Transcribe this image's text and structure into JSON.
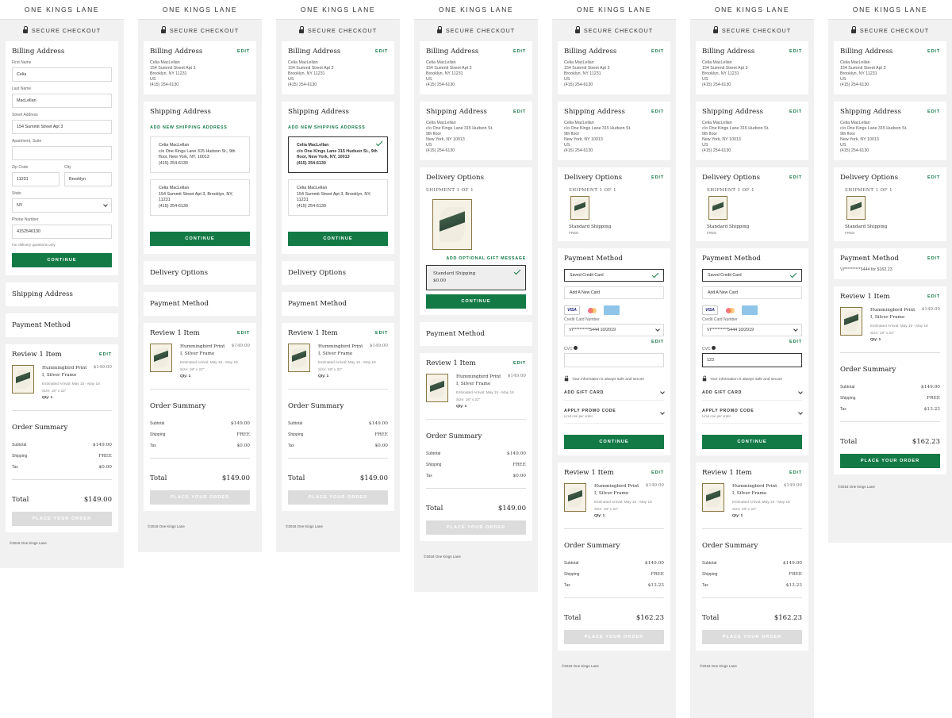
{
  "brand": "ONE KINGS LANE",
  "secure": "SECURE CHECKOUT",
  "footer": "©2018 One Kings Lane",
  "titles": {
    "billing": "Billing Address",
    "shipping": "Shipping Address",
    "delivery": "Delivery Options",
    "payment": "Payment Method",
    "review": "Review 1 Item",
    "summary": "Order Summary"
  },
  "edit": "EDIT",
  "billing_form": {
    "first_name_label": "First Name",
    "first_name": "Celia",
    "last_name_label": "Last Name",
    "last_name": "MacLellan",
    "street_label": "Street Address",
    "street": "154 Summit Street Apt 3",
    "apt_label": "Apartment, Suite",
    "apt": "",
    "zip_label": "Zip Code",
    "zip": "11231",
    "city_label": "City",
    "city": "Brooklyn",
    "state_label": "State",
    "state": "NY",
    "phone_label": "Phone Number",
    "phone": "4152546130",
    "note": "For delivery questions only"
  },
  "billing_addr": [
    "Celia MacLellan",
    "154 Summit Street Apt 3",
    "Brooklyn, NY 11231",
    "US",
    "(415) 254-6130"
  ],
  "shipping_addr": [
    "Celia MacLellan",
    "c/o One Kings Lane 315 Hudson St.",
    "9th floor",
    "New York, NY 10013",
    "US",
    "(415) 254-6130"
  ],
  "add_shipping": "ADD NEW SHIPPING ADDRESS",
  "ship_opts": [
    {
      "lines": [
        "Celia MacLellan",
        "c/o One Kings Lane 315 Hudson St., 9th floor, New York, NY, 10013",
        "(415) 254-6130"
      ]
    },
    {
      "lines": [
        "Celia MacLellan",
        "154 Summit Street Apt 3, Brooklyn, NY, 11231",
        "(415) 254-6130"
      ]
    }
  ],
  "continue": "CONTINUE",
  "place_order": "PLACE YOUR ORDER",
  "shipment": "SHIPMENT 1 OF 1",
  "gift": "ADD OPTIONAL GIFT MESSAGE",
  "std_ship": "Standard Shipping",
  "std_price": "$0.00",
  "free": "FREE",
  "payment": {
    "saved": "Saved Credit Card",
    "add_new": "Add A New Card",
    "cc_label": "Credit Card Number",
    "cc_value": "VI**********5444 10/2019",
    "cvc_label": "CVC",
    "cvc_value": "123",
    "safe": "Your information is always safe and secure",
    "gift_card": "ADD GIFT CARD",
    "promo": "APPLY PROMO CODE",
    "promo_note": "Limit one per order",
    "summary_line": "VI**********5444 for $162.23",
    "visa": "VISA"
  },
  "item": {
    "name": "Hummingbird Print I, Silver Frame",
    "price": "$149.00",
    "arrival": "Estimated Arrival: May 15 - May 18",
    "size": "Size: 18\" x 22\"",
    "qty": "Qty: 1"
  },
  "summary": {
    "subtotal_label": "Subtotal",
    "subtotal": "$149.00",
    "shipping_label": "Shipping",
    "shipping": "FREE",
    "tax_label": "Tax",
    "tax_a": "$0.00",
    "tax_b": "$13.23",
    "total_label": "Total",
    "total_a": "$149.00",
    "total_b": "$162.23"
  }
}
